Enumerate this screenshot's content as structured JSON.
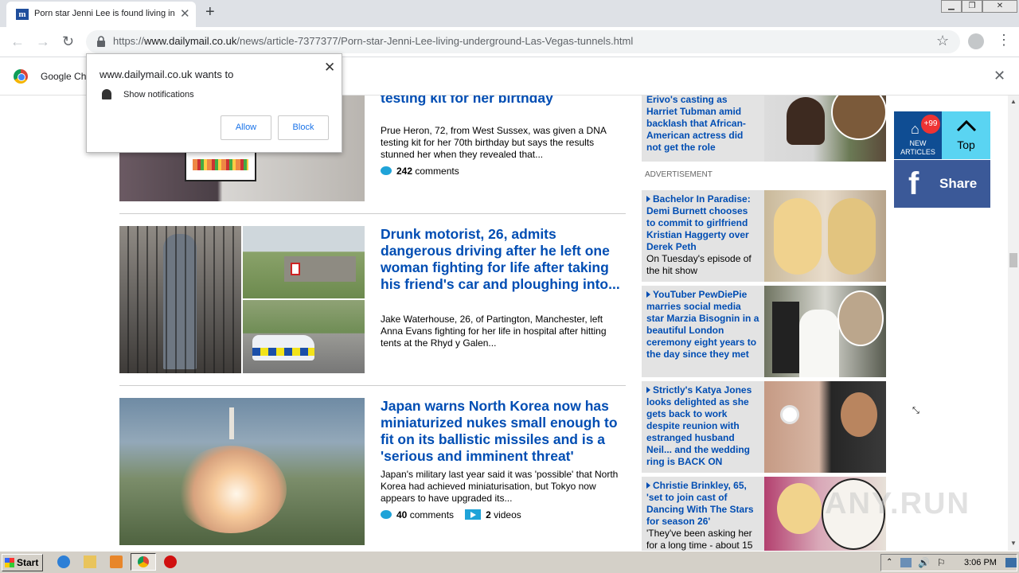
{
  "browser": {
    "tab_title": "Porn star Jenni Lee is found living in",
    "favicon_letter": "m",
    "url_scheme": "https://",
    "url_host": "www.dailymail.co.uk",
    "url_path": "/news/article-7377377/Porn-star-Jenni-Lee-living-underground-Las-Vegas-tunnels.html",
    "infobar_text": "Google Ch"
  },
  "notification": {
    "site_text": "www.dailymail.co.uk wants to",
    "permission_text": "Show notifications",
    "allow_label": "Allow",
    "block_label": "Block"
  },
  "articles": [
    {
      "headline": "real father after being given a DNA testing kit for her birthday",
      "summary": "Prue Heron, 72, from West Sussex, was given a DNA testing kit for her 70th birthday but says the results stunned her when they revealed that...",
      "comments_count": "242",
      "comments_label": "comments"
    },
    {
      "headline": "Drunk motorist, 26, admits dangerous driving after he left one woman fighting for life after taking his friend's car and ploughing into...",
      "summary": "Jake Waterhouse, 26, of Partington, Manchester, left Anna Evans fighting for her life in hospital after hitting tents at the Rhyd y Galen..."
    },
    {
      "headline": "Japan warns North Korea now has miniaturized nukes small enough to fit on its ballistic missiles and is a 'serious and imminent threat'",
      "summary": "Japan's military last year said it was 'possible' that North Korea had achieved miniaturisation, but Tokyo now appears to have upgraded its...",
      "comments_count": "40",
      "comments_label": "comments",
      "videos_count": "2",
      "videos_label": "videos"
    }
  ],
  "sidebar": {
    "top_card_text": "Erivo's casting as Harriet Tubman amid backlash that African-American actress did not get the role",
    "ad_label": "ADVERTISEMENT",
    "cards": [
      {
        "headline": "Bachelor In Paradise: Demi Burnett chooses to commit to girlfriend Kristian Haggerty over Derek Peth",
        "sub": "On Tuesday's episode of the hit show"
      },
      {
        "headline": "YouTuber PewDiePie marries social media star Marzia Bisognin in a beautiful London ceremony eight years to the day since they met",
        "sub": ""
      },
      {
        "headline": "Strictly's Katya Jones looks delighted as she gets back to work despite reunion with estranged husband Neil... and the wedding ring is BACK ON",
        "sub": ""
      },
      {
        "headline": "Christie Brinkley, 65, 'set to join cast of Dancing With The Stars for season 26'",
        "sub": "'They've been asking her for a long time - about 15"
      }
    ]
  },
  "floating": {
    "badge": "+99",
    "new_articles_label": "NEW ARTICLES",
    "top_label": "Top",
    "share_label": "Share"
  },
  "watermark": "ANY.RUN",
  "taskbar": {
    "start_label": "Start",
    "clock": "3:06 PM"
  }
}
